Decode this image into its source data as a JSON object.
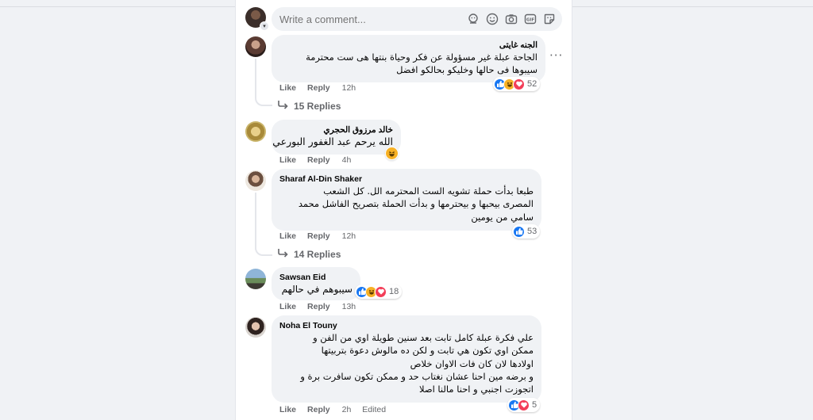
{
  "composer": {
    "placeholder": "Write a comment..."
  },
  "comments": [
    {
      "author": "الجنه غايتى",
      "lines": [
        "الجاحة عبلة غير مسؤولة عن فكر وحياة بنتها هى ست محترمة",
        "سيبوها فى حالها وخليكو بحالكو افضل"
      ],
      "like": "Like",
      "reply": "Reply",
      "time": "12h",
      "reactions": [
        "like-icon",
        "haha-icon",
        "love-icon"
      ],
      "reaction_count": "52",
      "replies": "15 Replies"
    },
    {
      "author": "خالد مرزوق الحجري",
      "lines": [
        "الله يرحم عبد الغفور البورعي"
      ],
      "like": "Like",
      "reply": "Reply",
      "time": "4h",
      "reactions": [
        "haha-icon"
      ]
    },
    {
      "author": "Sharaf Al-Din Shaker",
      "lines": [
        "طبعا بدأت حملة تشويه الست المحترمه الل. كل الشعب",
        "المصرى بيحبها و بيحترمها و بدأت الحملة بتصريح الفاشل محمد",
        "سامي من يومين"
      ],
      "like": "Like",
      "reply": "Reply",
      "time": "12h",
      "reactions": [
        "like-icon"
      ],
      "reaction_count": "53",
      "replies": "14 Replies"
    },
    {
      "author": "Sawsan Eid",
      "lines": [
        "سيبوهم في حالهم"
      ],
      "like": "Like",
      "reply": "Reply",
      "time": "13h",
      "reactions": [
        "like-icon",
        "haha-icon",
        "love-icon"
      ],
      "reaction_count": "18"
    },
    {
      "author": "Noha El Touny",
      "lines": [
        "علي فكرة عبلة كامل تابت بعد سنين طويلة اوي من الفن و",
        "ممكن اوي تكون هي تابت و لكن ده مالوش دعوة بتربيتها",
        "اولادها لان كان فات الاوان خلاص",
        "و برضه مين احنا عشان نغتاب حد و ممكن تكون سافرت برة و",
        "اتجوزت اجنبي و احنا مالنا اصلا"
      ],
      "like": "Like",
      "reply": "Reply",
      "time": "2h",
      "edited": "Edited",
      "reactions": [
        "like-icon",
        "love-icon"
      ],
      "reaction_count": "5"
    }
  ],
  "colors": {
    "like": "#1877f2",
    "love": "#f33e58",
    "haha": "#f7b125",
    "bubble": "#f0f2f5",
    "meta": "#65676b"
  }
}
